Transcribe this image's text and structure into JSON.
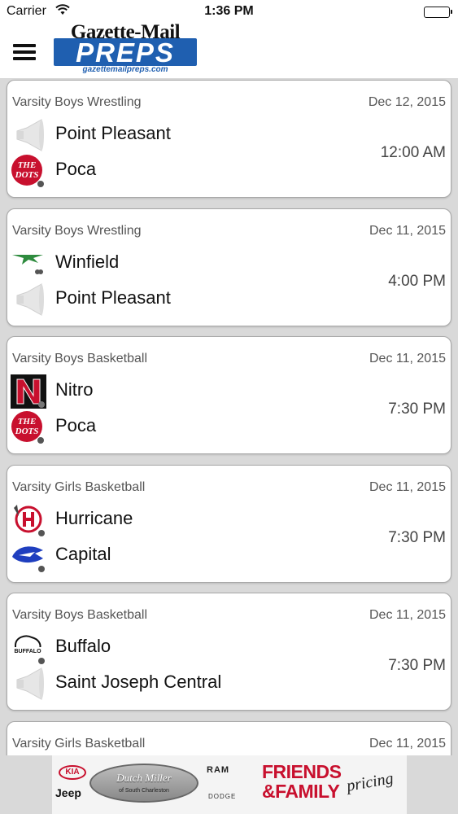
{
  "status_bar": {
    "carrier": "Carrier",
    "time": "1:36 PM",
    "icons": [
      "wifi-icon",
      "battery-icon"
    ]
  },
  "header": {
    "logo_top": "Gazette-Mail",
    "logo_main": "PREPS",
    "logo_url": "gazettemailpreps.com",
    "brand_color": "#1f5fb0",
    "menu_icon": "hamburger-menu-icon"
  },
  "games": [
    {
      "sport": "Varsity Boys Wrestling",
      "date": "Dec 12, 2015",
      "time": "12:00 AM",
      "home": {
        "name": "Point Pleasant",
        "logo": "megaphone-placeholder"
      },
      "away": {
        "name": "Poca",
        "logo": "poca-dots-logo"
      }
    },
    {
      "sport": "Varsity Boys Wrestling",
      "date": "Dec 11, 2015",
      "time": "4:00 PM",
      "home": {
        "name": "Winfield",
        "logo": "winfield-logo"
      },
      "away": {
        "name": "Point Pleasant",
        "logo": "megaphone-placeholder"
      }
    },
    {
      "sport": "Varsity Boys Basketball",
      "date": "Dec 11, 2015",
      "time": "7:30 PM",
      "home": {
        "name": "Nitro",
        "logo": "nitro-n-logo"
      },
      "away": {
        "name": "Poca",
        "logo": "poca-dots-logo"
      }
    },
    {
      "sport": "Varsity Girls Basketball",
      "date": "Dec 11, 2015",
      "time": "7:30 PM",
      "home": {
        "name": "Hurricane",
        "logo": "hurricane-h-logo"
      },
      "away": {
        "name": "Capital",
        "logo": "capital-cougar-logo"
      }
    },
    {
      "sport": "Varsity Boys Basketball",
      "date": "Dec 11, 2015",
      "time": "7:30 PM",
      "home": {
        "name": "Buffalo",
        "logo": "buffalo-logo"
      },
      "away": {
        "name": "Saint Joseph Central",
        "logo": "megaphone-placeholder"
      }
    },
    {
      "sport": "Varsity Girls Basketball",
      "date": "Dec 11, 2015",
      "time": "",
      "home": {
        "name": "",
        "logo": ""
      },
      "away": {
        "name": "",
        "logo": ""
      }
    }
  ],
  "ad": {
    "kia": "KIA",
    "jeep": "Jeep",
    "dealer": "Dutch Miller",
    "dealer_sub": "of South Charleston",
    "ram": "RAM",
    "dodge": "DODGE",
    "friends": "FRIENDS",
    "family": "&FAMILY",
    "pricing": "pricing",
    "accent_color": "#c8102e"
  }
}
